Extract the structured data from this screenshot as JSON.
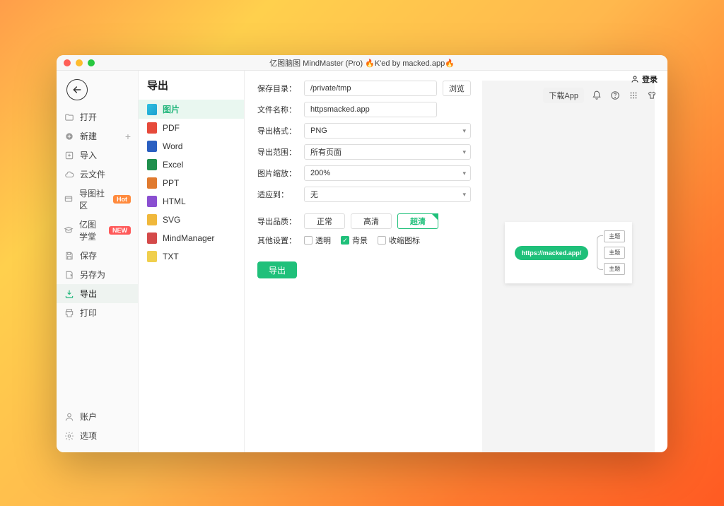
{
  "title": "亿图脑图 MindMaster (Pro) 🔥K'ed by macked.app🔥",
  "topbar": {
    "login": "登录",
    "dlapp": "下载App"
  },
  "nav": {
    "items": [
      {
        "label": "打开"
      },
      {
        "label": "新建",
        "plus": true
      },
      {
        "label": "导入"
      },
      {
        "label": "云文件"
      },
      {
        "label": "导图社区",
        "badge": "Hot",
        "badgeClass": "hot"
      },
      {
        "label": "亿图学堂",
        "badge": "NEW",
        "badgeClass": "new"
      },
      {
        "label": "保存"
      },
      {
        "label": "另存为"
      },
      {
        "label": "导出",
        "active": true
      },
      {
        "label": "打印"
      }
    ],
    "bottom": [
      {
        "label": "账户"
      },
      {
        "label": "选项"
      }
    ]
  },
  "panel2": {
    "heading": "导出",
    "formats": [
      {
        "label": "图片",
        "icon": "fico-img",
        "active": true
      },
      {
        "label": "PDF",
        "icon": "fico-pdf"
      },
      {
        "label": "Word",
        "icon": "fico-word"
      },
      {
        "label": "Excel",
        "icon": "fico-xls"
      },
      {
        "label": "PPT",
        "icon": "fico-ppt"
      },
      {
        "label": "HTML",
        "icon": "fico-html"
      },
      {
        "label": "SVG",
        "icon": "fico-svg"
      },
      {
        "label": "MindManager",
        "icon": "fico-mm"
      },
      {
        "label": "TXT",
        "icon": "fico-txt"
      }
    ]
  },
  "form": {
    "dir_label": "保存目录：",
    "dir_value": "/private/tmp",
    "browse": "浏览",
    "name_label": "文件名称：",
    "name_value": "httpsmacked.app",
    "fmt_label": "导出格式：",
    "fmt_value": "PNG",
    "range_label": "导出范围：",
    "range_value": "所有页面",
    "zoom_label": "图片缩放：",
    "zoom_value": "200%",
    "fit_label": "适应到：",
    "fit_value": "无",
    "quality_label": "导出品质：",
    "quality_options": [
      "正常",
      "高清",
      "超清"
    ],
    "quality_selected": 2,
    "other_label": "其他设置：",
    "opt_transparent": "透明",
    "opt_bg": "背景",
    "opt_collapse": "收缩图标",
    "export_btn": "导出"
  },
  "preview": {
    "root": "https://macked.app/",
    "nodes": [
      "主题",
      "主题",
      "主题"
    ]
  }
}
